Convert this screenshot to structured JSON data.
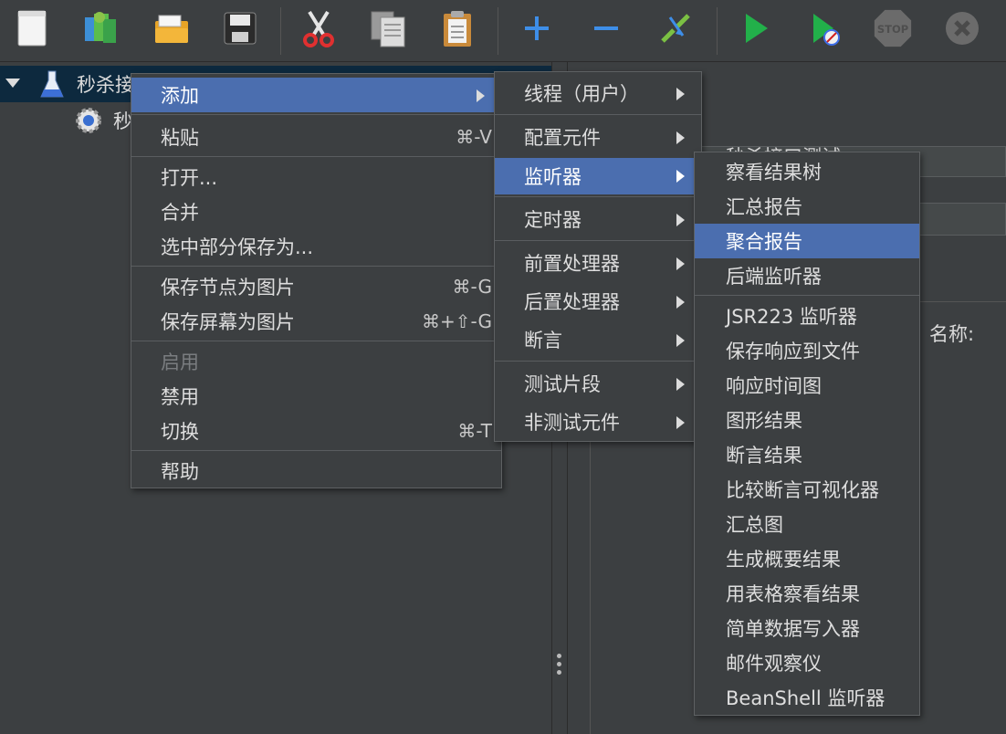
{
  "toolbar": {
    "buttons": [
      {
        "name": "new-icon"
      },
      {
        "name": "templates-icon"
      },
      {
        "name": "open-icon"
      },
      {
        "name": "save-icon"
      },
      {
        "name": "cut-icon"
      },
      {
        "name": "copy-icon"
      },
      {
        "name": "paste-icon"
      },
      {
        "name": "expand-icon"
      },
      {
        "name": "collapse-icon"
      },
      {
        "name": "toggle-icon"
      },
      {
        "name": "start-icon"
      },
      {
        "name": "start-no-pauses-icon"
      },
      {
        "name": "stop-icon"
      },
      {
        "name": "shutdown-icon"
      }
    ],
    "stop_text": "STOP"
  },
  "tree": {
    "root_label": "秒杀接",
    "child_label": "秒"
  },
  "right_panel": {
    "title_text": "秒杀接口测试",
    "name_label": "名称:"
  },
  "context_menu": {
    "items": [
      {
        "label": "添加",
        "submenu": true
      },
      {
        "label": "粘贴",
        "shortcut": "⌘-V"
      },
      {
        "label": "打开..."
      },
      {
        "label": "合并"
      },
      {
        "label": "选中部分保存为..."
      },
      {
        "label": "保存节点为图片",
        "shortcut": "⌘-G"
      },
      {
        "label": "保存屏幕为图片",
        "shortcut": "⌘+⇧-G"
      },
      {
        "label": "启用",
        "disabled": true
      },
      {
        "label": "禁用"
      },
      {
        "label": "切换",
        "shortcut": "⌘-T"
      },
      {
        "label": "帮助"
      }
    ]
  },
  "add_menu": {
    "items": [
      {
        "label": "线程（用户）"
      },
      {
        "label": "配置元件"
      },
      {
        "label": "监听器"
      },
      {
        "label": "定时器"
      },
      {
        "label": "前置处理器"
      },
      {
        "label": "后置处理器"
      },
      {
        "label": "断言"
      },
      {
        "label": "测试片段"
      },
      {
        "label": "非测试元件"
      }
    ]
  },
  "listener_menu": {
    "items": [
      {
        "label": "察看结果树"
      },
      {
        "label": "汇总报告"
      },
      {
        "label": "聚合报告"
      },
      {
        "label": "后端监听器"
      },
      {
        "label": "JSR223 监听器"
      },
      {
        "label": "保存响应到文件"
      },
      {
        "label": "响应时间图"
      },
      {
        "label": "图形结果"
      },
      {
        "label": "断言结果"
      },
      {
        "label": "比较断言可视化器"
      },
      {
        "label": "汇总图"
      },
      {
        "label": "生成概要结果"
      },
      {
        "label": "用表格察看结果"
      },
      {
        "label": "简单数据写入器"
      },
      {
        "label": "邮件观察仪"
      },
      {
        "label": "BeanShell 监听器"
      }
    ]
  },
  "colors": {
    "background": "#3c3f41",
    "highlight": "#4b6eaf",
    "tree_selected": "#0d293e",
    "green": "#2ea043"
  }
}
